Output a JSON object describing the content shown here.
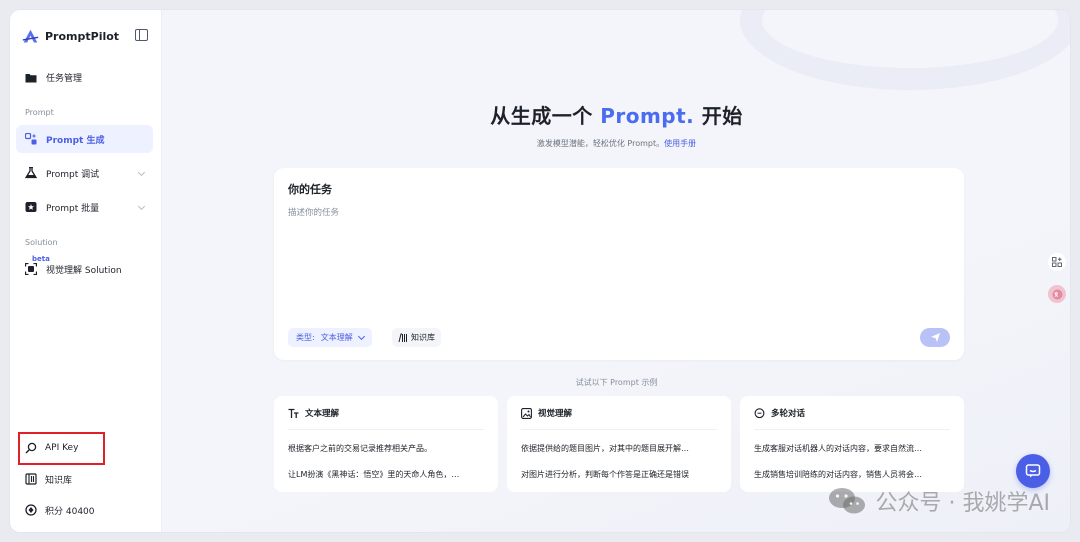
{
  "app": {
    "name": "PromptPilot"
  },
  "sidebar": {
    "task_mgmt": "任务管理",
    "section_prompt": "Prompt",
    "prompt_generate": "Prompt 生成",
    "prompt_debug": "Prompt 调试",
    "prompt_batch": "Prompt 批量",
    "section_solution": "Solution",
    "beta": "beta",
    "visual_solution": "视觉理解 Solution",
    "api_key": "API Key",
    "knowledge_base": "知识库",
    "points": "积分 40400"
  },
  "main": {
    "title_prefix": "从生成一个",
    "title_accent": "Prompt.",
    "title_suffix": "开始",
    "subtitle": "激发模型潜能，轻松优化 Prompt。",
    "manual_link": "使用手册",
    "task_title": "你的任务",
    "task_placeholder": "描述你的任务",
    "type_label": "类型:",
    "type_value": "文本理解",
    "kb_chip": "知识库",
    "examples_label": "试试以下 Prompt 示例"
  },
  "examples": [
    {
      "title": "文本理解",
      "icon": "text-icon",
      "lines": [
        "根据客户之前的交易记录推荐相关产品。",
        "让LM扮演《黑神话：悟空》里的天命人角色，…"
      ]
    },
    {
      "title": "视觉理解",
      "icon": "image-icon",
      "lines": [
        "依据提供给的题目图片，对其中的题目展开解…",
        "对图片进行分析，判断每个作答是正确还是错误"
      ]
    },
    {
      "title": "多轮对话",
      "icon": "chat-bubble-icon",
      "lines": [
        "生成客服对话机器人的对话内容，要求自然流…",
        "生成销售培训陪练的对话内容，销售人员将会…"
      ]
    }
  ],
  "watermark": "公众号 · 我姚学AI",
  "colors": {
    "accent": "#4b5fe6",
    "highlight_box": "#e0202a"
  }
}
